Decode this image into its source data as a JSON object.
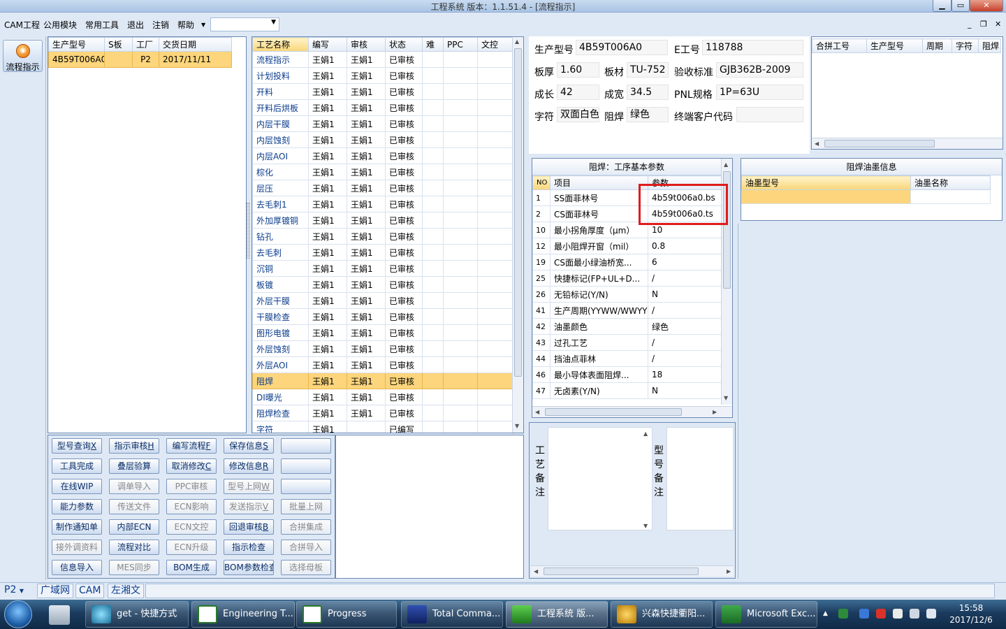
{
  "window": {
    "title": "工程系统   版本：1.1.51.4 - [流程指示]",
    "min": "▁",
    "max": "▭",
    "close": "✕"
  },
  "menu": {
    "items": [
      "CAM工程",
      "公用模块",
      "常用工具",
      "退出",
      "注销",
      "帮助"
    ],
    "combo_value": "",
    "mdi": [
      "_",
      "❐",
      "✕"
    ]
  },
  "leftbar": {
    "flow_button": "流程指示"
  },
  "product_list": {
    "headers": [
      "生产型号",
      "S板",
      "工厂",
      "交货日期"
    ],
    "rows": [
      [
        "4B59T006A0",
        "",
        "P2",
        "2017/11/11"
      ]
    ]
  },
  "process": {
    "headers": [
      "工艺名称",
      "编写",
      "审核",
      "状态",
      "难",
      "PPC",
      "文控"
    ],
    "rows": [
      [
        "流程指示",
        "王娟1",
        "王娟1",
        "已审核"
      ],
      [
        "计划投料",
        "王娟1",
        "王娟1",
        "已审核"
      ],
      [
        "开料",
        "王娟1",
        "王娟1",
        "已审核"
      ],
      [
        "开料后烘板",
        "王娟1",
        "王娟1",
        "已审核"
      ],
      [
        "内层干膜",
        "王娟1",
        "王娟1",
        "已审核"
      ],
      [
        "内层蚀刻",
        "王娟1",
        "王娟1",
        "已审核"
      ],
      [
        "内层AOI",
        "王娟1",
        "王娟1",
        "已审核"
      ],
      [
        "棕化",
        "王娟1",
        "王娟1",
        "已审核"
      ],
      [
        "层压",
        "王娟1",
        "王娟1",
        "已审核"
      ],
      [
        "去毛刺1",
        "王娟1",
        "王娟1",
        "已审核"
      ],
      [
        "外加厚镀铜",
        "王娟1",
        "王娟1",
        "已审核"
      ],
      [
        "钻孔",
        "王娟1",
        "王娟1",
        "已审核"
      ],
      [
        "去毛刺",
        "王娟1",
        "王娟1",
        "已审核"
      ],
      [
        "沉铜",
        "王娟1",
        "王娟1",
        "已审核"
      ],
      [
        "板镀",
        "王娟1",
        "王娟1",
        "已审核"
      ],
      [
        "外层干膜",
        "王娟1",
        "王娟1",
        "已审核"
      ],
      [
        "干膜检查",
        "王娟1",
        "王娟1",
        "已审核"
      ],
      [
        "图形电镀",
        "王娟1",
        "王娟1",
        "已审核"
      ],
      [
        "外层蚀刻",
        "王娟1",
        "王娟1",
        "已审核"
      ],
      [
        "外层AOI",
        "王娟1",
        "王娟1",
        "已审核"
      ],
      [
        "阻焊",
        "王娟1",
        "王娟1",
        "已审核"
      ],
      [
        "DI曝光",
        "王娟1",
        "王娟1",
        "已审核"
      ],
      [
        "阻焊检查",
        "王娟1",
        "王娟1",
        "已审核"
      ],
      [
        "字符",
        "王娟1",
        "",
        "已编写"
      ]
    ],
    "selected_index": 20
  },
  "buttons": [
    [
      "型号查询",
      "X"
    ],
    [
      "指示审核",
      "H"
    ],
    [
      "编写流程",
      "F"
    ],
    [
      "保存信息",
      "S"
    ],
    [
      "",
      ""
    ],
    [
      "工具完成",
      ""
    ],
    [
      "叠层验算",
      ""
    ],
    [
      "取消修改",
      "C"
    ],
    [
      "修改信息",
      "R"
    ],
    [
      "",
      ""
    ],
    [
      "在线WIP",
      ""
    ],
    [
      "调单导入",
      ""
    ],
    [
      "PPC审核",
      ""
    ],
    [
      "型号上网",
      "W"
    ],
    [
      "",
      ""
    ],
    [
      "能力参数",
      ""
    ],
    [
      "传送文件",
      ""
    ],
    [
      "ECN影响",
      ""
    ],
    [
      "发送指示",
      "V"
    ],
    [
      "批量上网",
      ""
    ],
    [
      "制作通知单",
      ""
    ],
    [
      "内部ECN",
      ""
    ],
    [
      "ECN文控",
      ""
    ],
    [
      "回退审核",
      "B"
    ],
    [
      "合拼集成",
      ""
    ],
    [
      "接外调资料",
      ""
    ],
    [
      "流程对比",
      ""
    ],
    [
      "ECN升级",
      ""
    ],
    [
      "指示检查",
      ""
    ],
    [
      "合拼导入",
      ""
    ],
    [
      "信息导入",
      ""
    ],
    [
      "MES同步",
      ""
    ],
    [
      "BOM生成",
      ""
    ],
    [
      "BOM参数检查",
      ""
    ],
    [
      "选择母板",
      ""
    ]
  ],
  "button_disabled": [
    false,
    false,
    false,
    false,
    false,
    false,
    false,
    false,
    false,
    false,
    false,
    true,
    true,
    true,
    false,
    false,
    true,
    true,
    true,
    true,
    false,
    false,
    true,
    false,
    true,
    true,
    false,
    true,
    false,
    true,
    false,
    true,
    false,
    false,
    true
  ],
  "info": {
    "prod_model_label": "生产型号",
    "prod_model": "4B59T006A0",
    "e_no_label": "E工号",
    "e_no": "118788",
    "thickness_label": "板厚",
    "thickness": "1.60",
    "material_label": "板材",
    "material": "TU-752",
    "acceptance_label": "验收标准",
    "acceptance": "GJB362B-2009",
    "length_label": "成长",
    "length": "42",
    "width_label": "成宽",
    "width": "34.5",
    "pnl_label": "PNL规格",
    "pnl": "1P=63U",
    "char_label": "字符",
    "char": "双面白色",
    "mask_label": "阻焊",
    "mask": "绿色",
    "customer_code_label": "终端客户代码",
    "customer_code": ""
  },
  "merge": {
    "headers": [
      "合拼工号",
      "生产型号",
      "周期",
      "字符",
      "阻焊"
    ]
  },
  "params": {
    "title": "阻焊：工序基本参数",
    "headers": [
      "NO",
      "项目",
      "参数"
    ],
    "rows": [
      [
        "1",
        "SS面菲林号",
        "4b59t006a0.bs"
      ],
      [
        "2",
        "CS面菲林号",
        "4b59t006a0.ts"
      ],
      [
        "10",
        "最小拐角厚度（μm）",
        "10"
      ],
      [
        "12",
        "最小阻焊开窗（mil）",
        "0.8"
      ],
      [
        "19",
        "CS面最小绿油桥宽...",
        "6"
      ],
      [
        "25",
        "快捷标记(FP+UL+D...",
        "/"
      ],
      [
        "26",
        "无铅标记(Y/N)",
        "N"
      ],
      [
        "41",
        "生产周期(YYWW/WWYY)",
        "/"
      ],
      [
        "42",
        "油墨颜色",
        "绿色"
      ],
      [
        "43",
        "过孔工艺",
        "/"
      ],
      [
        "44",
        "挡油点菲林",
        "/"
      ],
      [
        "46",
        "最小导体表面阻焊...",
        "18"
      ],
      [
        "47",
        "无卤素(Y/N)",
        "N"
      ]
    ]
  },
  "ink": {
    "title": "阻焊油墨信息",
    "headers": [
      "油墨型号",
      "油墨名称"
    ]
  },
  "notes": {
    "process_note": "工艺备注",
    "model_note": "型号备注"
  },
  "status": {
    "factory": "P2",
    "tabs": [
      "广域网",
      "CAM",
      "左湘文"
    ]
  },
  "taskbar": {
    "tasks": [
      "get - 快捷方式",
      "Engineering T...",
      "Progress",
      "Total Comma...",
      "工程系统  版...",
      "兴森快捷衢阳...",
      "Microsoft Exc..."
    ],
    "time": "15:58",
    "date": "2017/12/6"
  }
}
